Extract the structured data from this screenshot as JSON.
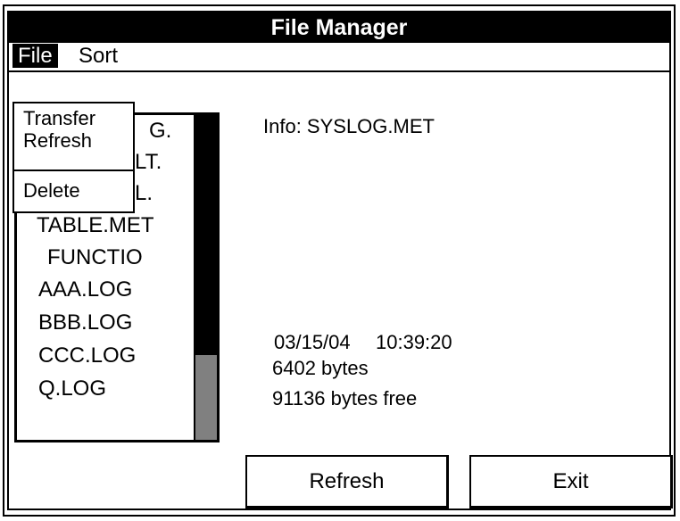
{
  "title": "File Manager",
  "menu": {
    "file": "File",
    "sort": "Sort"
  },
  "file_menu_items": [
    "Transfer",
    "Refresh",
    "Delete"
  ],
  "files_partial": [
    "G.",
    "LT.",
    "L."
  ],
  "files": [
    "TABLE.MET",
    "FUNCTIO",
    "AAA.LOG",
    "BBB.LOG",
    "CCC.LOG",
    "Q.LOG"
  ],
  "info": {
    "label": "Info: SYSLOG.MET",
    "date": "03/15/04",
    "time": "10:39:20",
    "size": "6402 bytes",
    "free": "91136 bytes free"
  },
  "buttons": {
    "refresh": "Refresh",
    "exit": "Exit"
  },
  "colors": {
    "titlebar": "#000000",
    "scroll_thumb": "#808080"
  }
}
